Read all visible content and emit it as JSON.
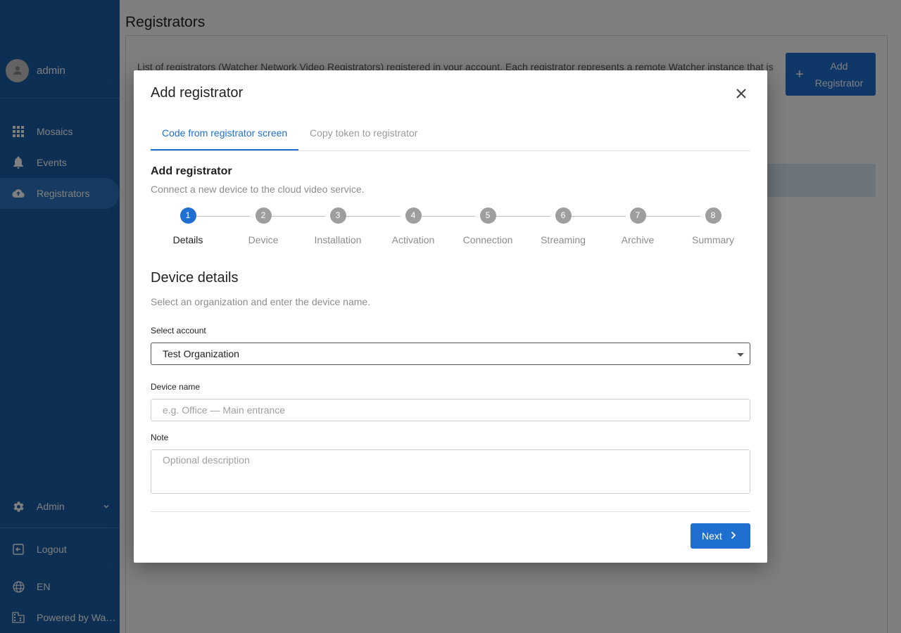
{
  "sidebar": {
    "user": {
      "name": "admin",
      "icon": "person-icon"
    },
    "nav": [
      {
        "label": "Mosaics",
        "icon": "grid-icon"
      },
      {
        "label": "Events",
        "icon": "bell-icon"
      },
      {
        "label": "Registrators",
        "icon": "cloud-upload-icon",
        "active": true
      }
    ],
    "bottom": [
      {
        "label": "Admin",
        "icon": "gear-icon"
      },
      {
        "label": "Logout",
        "icon": "logout-icon"
      },
      {
        "label": "EN",
        "icon": "globe-icon"
      },
      {
        "label": "Powered by Wat…",
        "icon": "building-icon"
      }
    ]
  },
  "page": {
    "title": "Registrators",
    "intro": "List of registrators (Watcher Network Video Registrators) registered in your account. Each registrator represents a remote Watcher instance that is",
    "add_button": "Add Registrator"
  },
  "modal": {
    "title": "Add registrator",
    "tabs": [
      {
        "label": "Code from registrator screen",
        "active": true
      },
      {
        "label": "Copy token to registrator",
        "active": false
      }
    ],
    "section_title": "Add registrator",
    "section_subtitle": "Connect a new device to the cloud video service.",
    "steps": [
      {
        "num": "1",
        "label": "Details",
        "active": true
      },
      {
        "num": "2",
        "label": "Device"
      },
      {
        "num": "3",
        "label": "Installation"
      },
      {
        "num": "4",
        "label": "Activation"
      },
      {
        "num": "5",
        "label": "Connection"
      },
      {
        "num": "6",
        "label": "Streaming"
      },
      {
        "num": "7",
        "label": "Archive"
      },
      {
        "num": "8",
        "label": "Summary"
      }
    ],
    "details_title": "Device details",
    "details_subtitle": "Select an organization and enter the device name.",
    "account_label": "Select account",
    "account_value": "Test Organization",
    "device_name_label": "Device name",
    "device_name_placeholder": "e.g. Office — Main entrance",
    "note_label": "Note",
    "note_placeholder": "Optional description",
    "next_button": "Next"
  },
  "colors": {
    "sidebar": "#1c5ea8",
    "accent": "#1e6fd0",
    "step_inactive": "#9e9e9e"
  }
}
